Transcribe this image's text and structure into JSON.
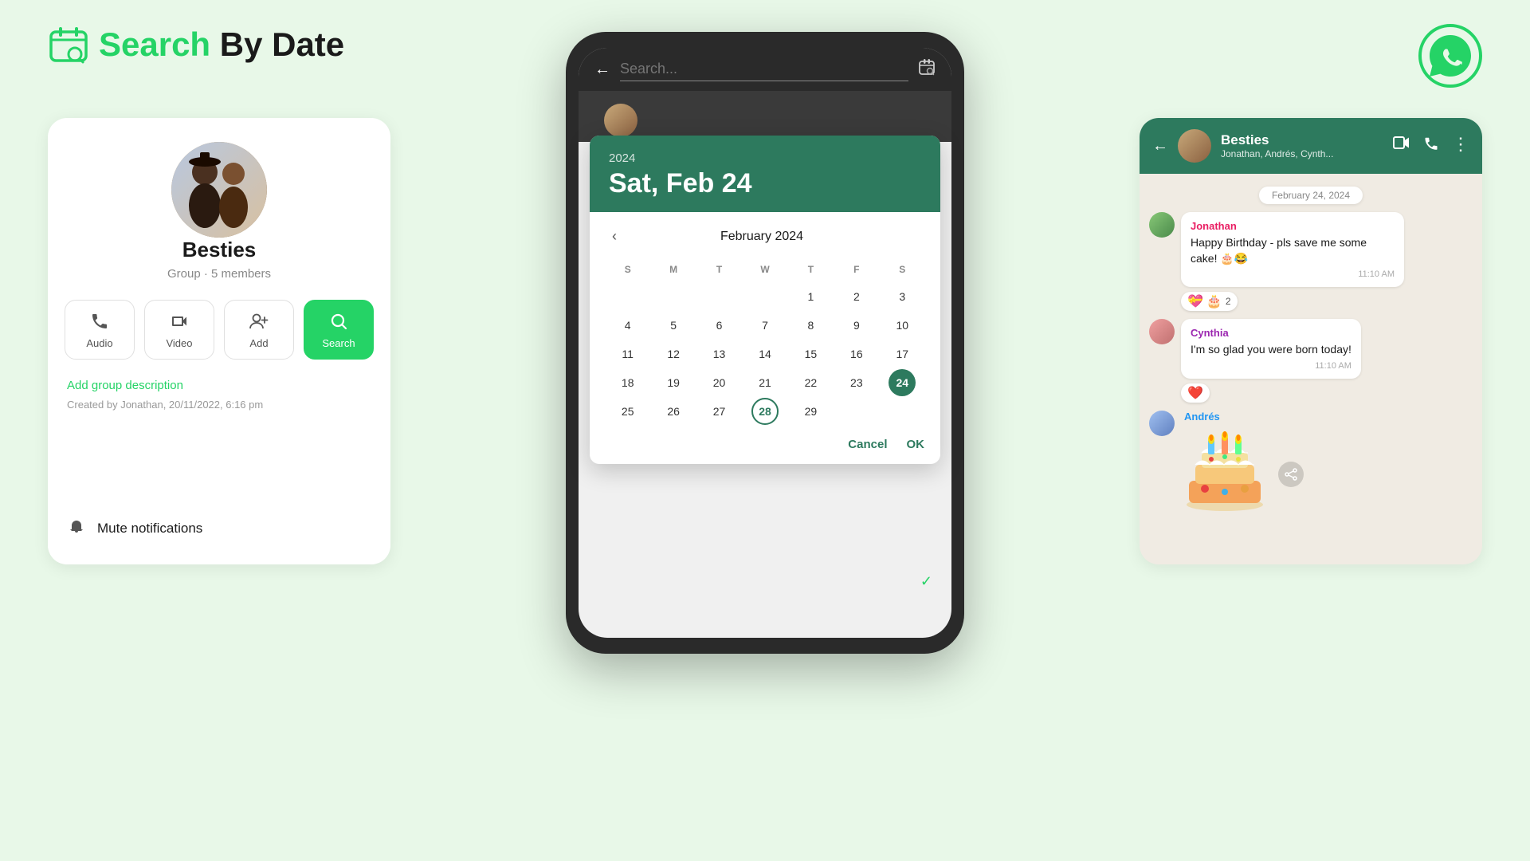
{
  "header": {
    "title_green": "Search",
    "title_dark": " By Date"
  },
  "left_panel": {
    "group_name": "Besties",
    "group_meta": "Group · 5 members",
    "actions": [
      {
        "label": "Audio",
        "icon": "📞"
      },
      {
        "label": "Video",
        "icon": "📹"
      },
      {
        "label": "Add",
        "icon": "➕"
      },
      {
        "label": "Search",
        "icon": "🔍",
        "active": true
      }
    ],
    "add_description": "Add group description",
    "created_by": "Created by Jonathan, 20/11/2022, 6:16 pm",
    "mute_label": "Mute notifications"
  },
  "center_phone": {
    "search_placeholder": "Search...",
    "date_picker": {
      "year": "2024",
      "date_display": "Sat, Feb 24",
      "month_title": "February 2024",
      "days_header": [
        "S",
        "M",
        "T",
        "W",
        "T",
        "F",
        "S"
      ],
      "selected_day": 24,
      "today_circle": 28,
      "weeks": [
        [
          "",
          "",
          "",
          "",
          "1",
          "2",
          "3"
        ],
        [
          "4",
          "5",
          "6",
          "7",
          "8",
          "9",
          "10"
        ],
        [
          "11",
          "12",
          "13",
          "14",
          "15",
          "16",
          "17"
        ],
        [
          "18",
          "19",
          "20",
          "21",
          "22",
          "23",
          "24"
        ],
        [
          "25",
          "26",
          "27",
          "28",
          "29",
          "",
          ""
        ]
      ],
      "cancel_label": "Cancel",
      "ok_label": "OK"
    }
  },
  "right_panel": {
    "chat_title": "Besties",
    "chat_subtitle": "Jonathan, Andrés, Cynth...",
    "date_badge": "February 24, 2024",
    "messages": [
      {
        "sender": "Jonathan",
        "sender_class": "jonathan",
        "text": "Happy Birthday - pls save me some cake! 🎂😂",
        "time": "11:10 AM",
        "reactions": [
          "💝",
          "🎂",
          "2"
        ]
      },
      {
        "sender": "Cynthia",
        "sender_class": "cynthia",
        "text": "I'm so glad you were born today!",
        "time": "11:10 AM",
        "reactions": [
          "❤️"
        ]
      },
      {
        "sender": "Andrés",
        "sender_class": "andres",
        "is_sticker": true
      }
    ]
  }
}
